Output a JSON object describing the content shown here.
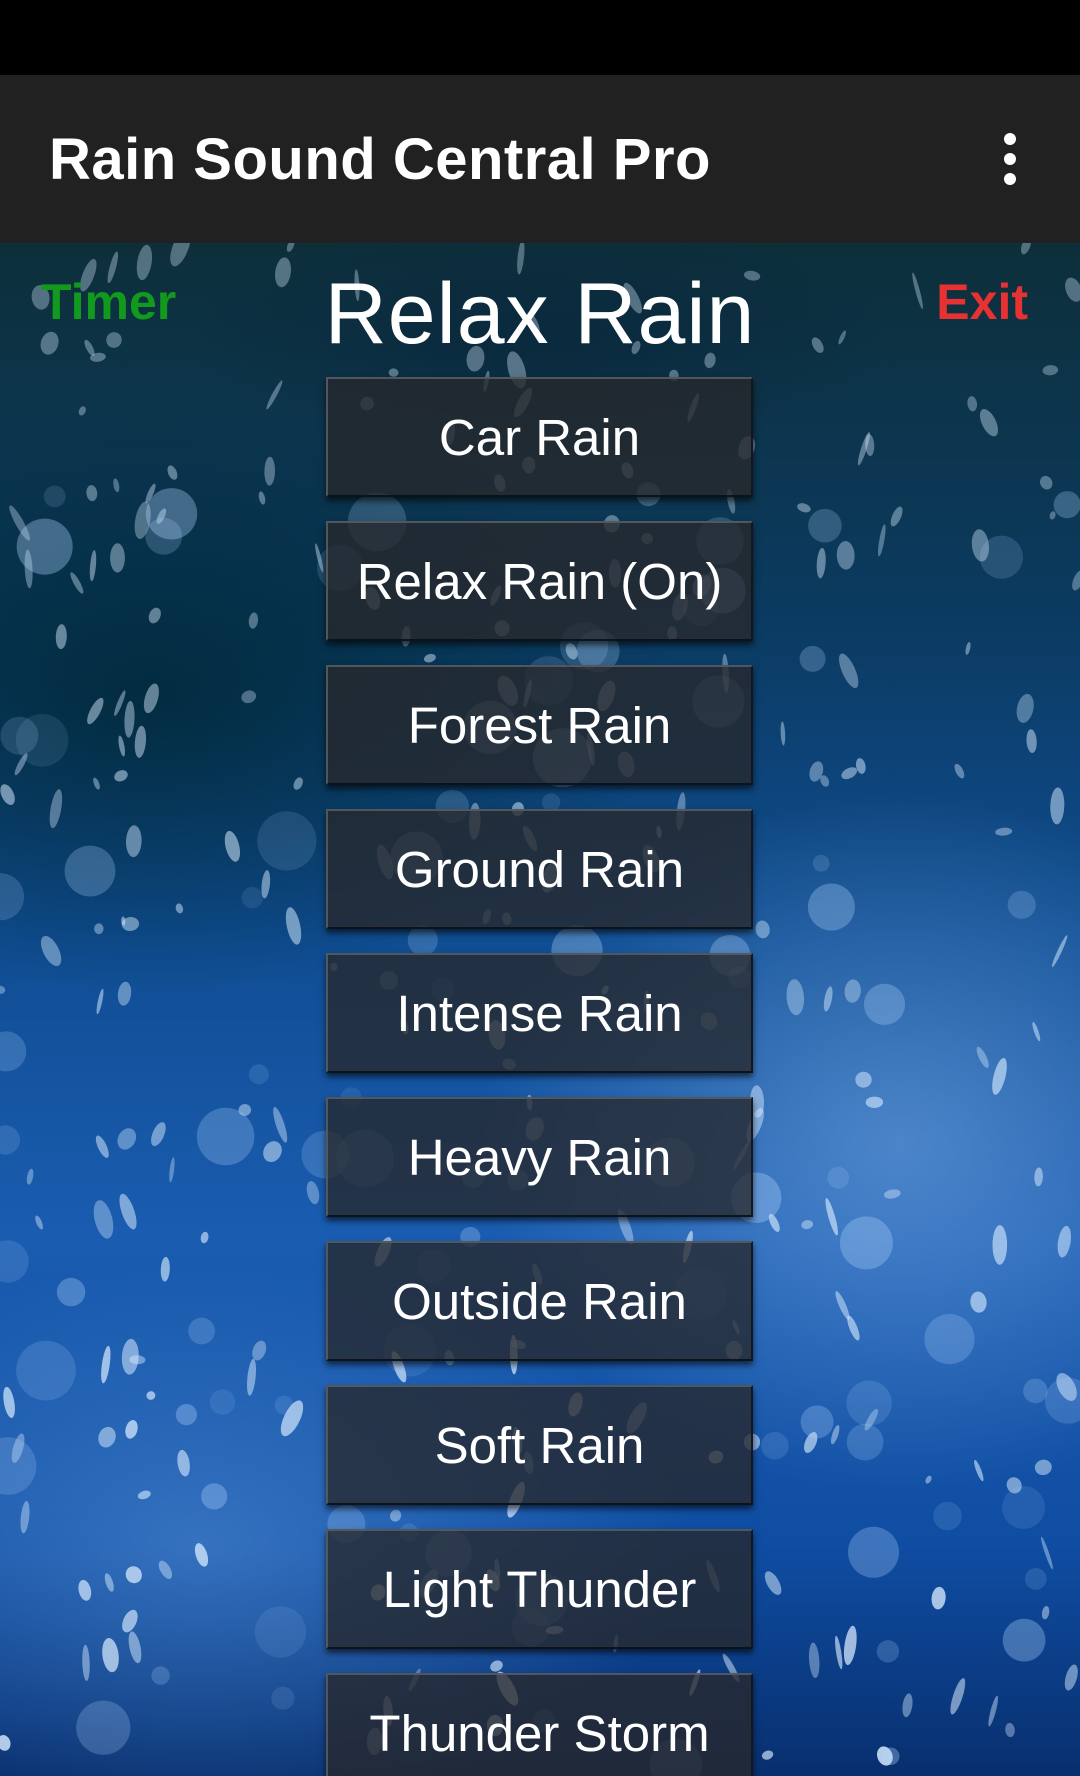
{
  "app_bar": {
    "title": "Rain Sound Central Pro",
    "menu_icon": "more-vert-icon"
  },
  "header": {
    "timer_label": "Timer",
    "now_playing_title": "Relax Rain",
    "exit_label": "Exit"
  },
  "colors": {
    "timer": "#129a1e",
    "exit": "#e63232",
    "app_bar_bg": "#212121"
  },
  "sounds": [
    {
      "label": "Car Rain"
    },
    {
      "label": "Relax Rain (On)"
    },
    {
      "label": "Forest Rain"
    },
    {
      "label": "Ground Rain"
    },
    {
      "label": "Intense Rain"
    },
    {
      "label": "Heavy Rain"
    },
    {
      "label": "Outside Rain"
    },
    {
      "label": "Soft Rain"
    },
    {
      "label": "Light Thunder"
    },
    {
      "label": "Thunder Storm"
    }
  ]
}
